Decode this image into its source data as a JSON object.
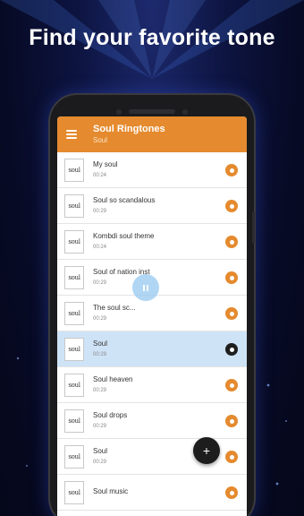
{
  "headline": "Find your favorite tone",
  "appbar": {
    "title": "Soul Ringtones",
    "subtitle": "Soul"
  },
  "ringtones": [
    {
      "thumb": "soul",
      "title": "My soul",
      "duration": "00:24"
    },
    {
      "thumb": "soul",
      "title": "Soul so scandalous",
      "duration": "00:29"
    },
    {
      "thumb": "soul",
      "title": "Kombdi soul theme",
      "duration": "00:24"
    },
    {
      "thumb": "soul",
      "title": "Soul of nation inst",
      "duration": "00:29"
    },
    {
      "thumb": "soul",
      "title": "The soul sc...",
      "duration": "00:29"
    },
    {
      "thumb": "soul",
      "title": "Soul",
      "duration": "00:29"
    },
    {
      "thumb": "soul",
      "title": "Soul heaven",
      "duration": "00:29"
    },
    {
      "thumb": "soul",
      "title": "Soul drops",
      "duration": "00:29"
    },
    {
      "thumb": "soul",
      "title": "Soul",
      "duration": "00:29"
    },
    {
      "thumb": "soul",
      "title": "Soul music",
      "duration": ""
    }
  ],
  "active_index": 5,
  "fab_label": "+",
  "colors": {
    "accent": "#e58a2e",
    "selected_row": "#cfe3f7",
    "fab": "#1d1d1d"
  }
}
